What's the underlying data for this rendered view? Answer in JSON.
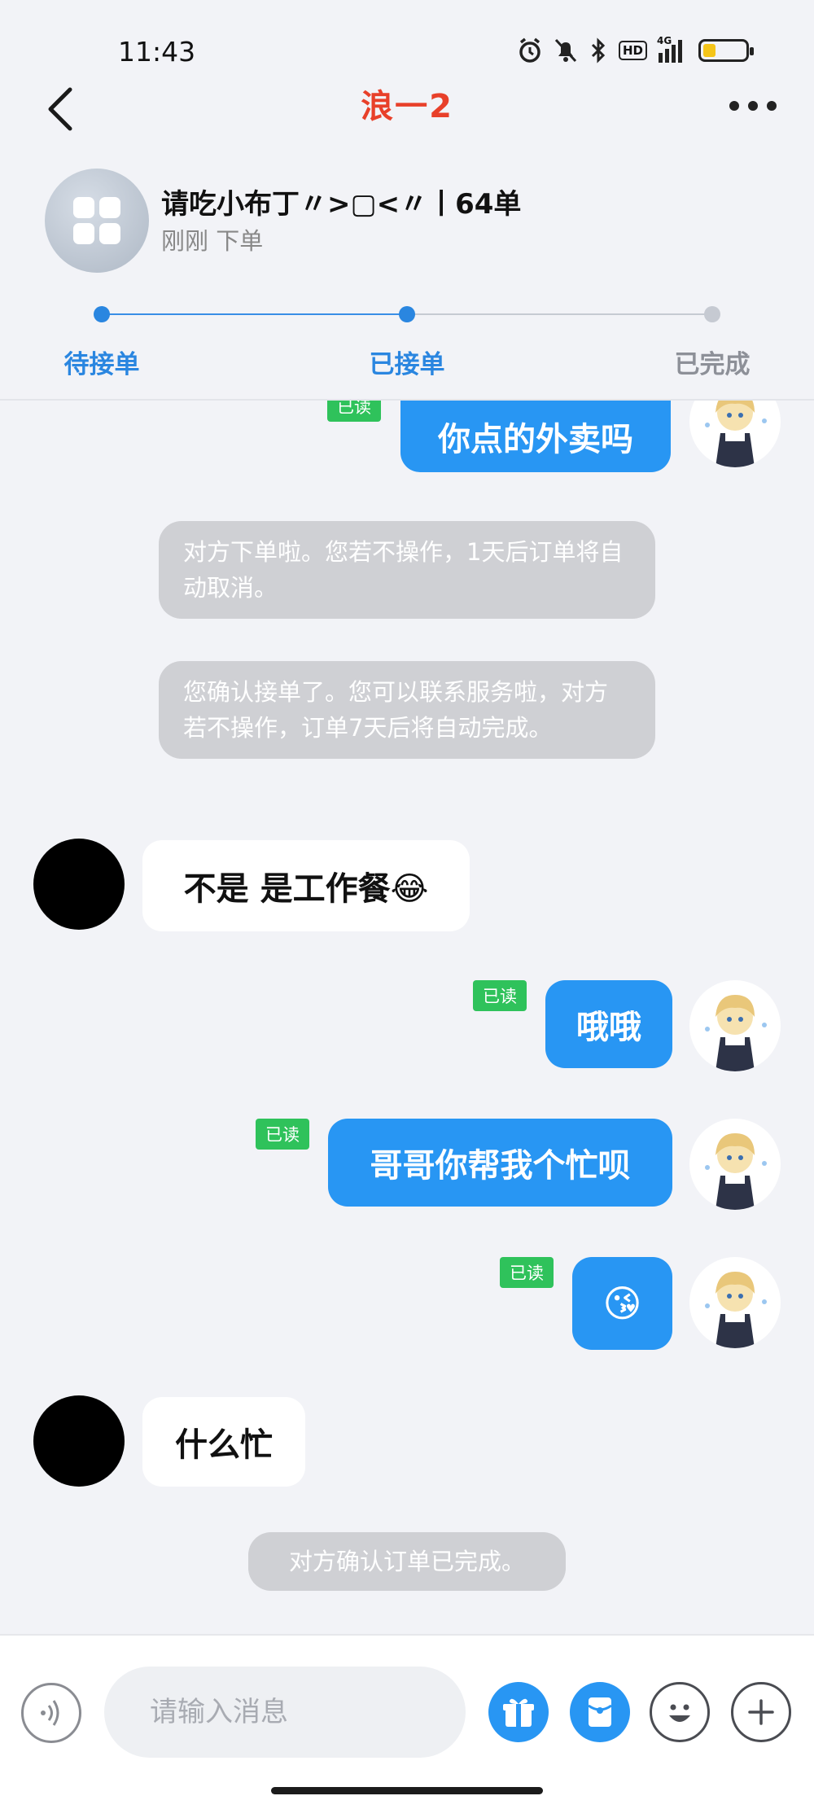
{
  "status_bar": {
    "time": "11:43",
    "network_label": "4G",
    "hd_label": "HD",
    "battery_percent": 30
  },
  "nav": {
    "title": "浪一2"
  },
  "order": {
    "name": "请吃小布丁〃>▢<〃丨64单",
    "subtitle": "刚刚 下单"
  },
  "progress": {
    "steps": [
      {
        "label": "待接单",
        "color": "#2a86e0"
      },
      {
        "label": "已接单",
        "color": "#2a86e0"
      },
      {
        "label": "已完成",
        "color": "#8d9098"
      }
    ],
    "current_step": 2
  },
  "chat": {
    "read_label": "已读",
    "messages": [
      {
        "type": "out",
        "text": "你点的外卖吗"
      },
      {
        "type": "system",
        "text": "对方下单啦。您若不操作，1天后订单将自动取消。"
      },
      {
        "type": "system",
        "text": "您确认接单了。您可以联系服务啦，对方若不操作，订单7天后将自动完成。"
      },
      {
        "type": "in",
        "text": "不是 是工作餐😂"
      },
      {
        "type": "out",
        "text": "哦哦"
      },
      {
        "type": "out",
        "text": "哥哥你帮我个忙呗"
      },
      {
        "type": "out",
        "text": "😘"
      },
      {
        "type": "in",
        "text": "什么忙"
      },
      {
        "type": "system",
        "text": "对方确认订单已完成。"
      }
    ]
  },
  "input": {
    "placeholder": "请输入消息"
  },
  "colors": {
    "accent": "#2896f3",
    "title_red": "#e8402a",
    "read_green": "#2fc25b"
  }
}
